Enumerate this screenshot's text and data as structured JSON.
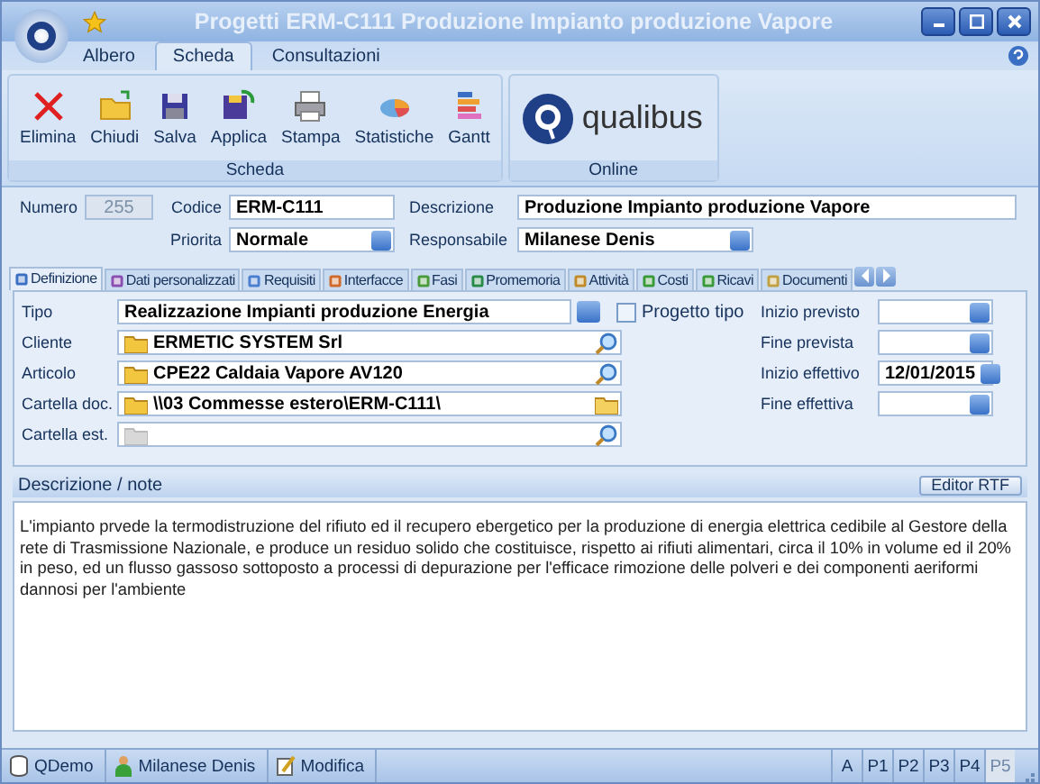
{
  "window": {
    "title": "Progetti ERM-C111 Produzione Impianto produzione Vapore"
  },
  "ribbon": {
    "tabs": [
      {
        "label": "Albero",
        "selected": false
      },
      {
        "label": "Scheda",
        "selected": true
      },
      {
        "label": "Consultazioni",
        "selected": false
      }
    ],
    "groups": [
      {
        "label": "Scheda",
        "buttons": [
          "Elimina",
          "Chiudi",
          "Salva",
          "Applica",
          "Stampa",
          "Statistiche",
          "Gantt"
        ]
      },
      {
        "label": "Online",
        "logo": "qualibus"
      }
    ]
  },
  "header": {
    "numero": {
      "label": "Numero",
      "value": "255",
      "disabled": true
    },
    "codice": {
      "label": "Codice",
      "value": "ERM-C111"
    },
    "descrizione": {
      "label": "Descrizione",
      "value": "Produzione Impianto produzione Vapore"
    },
    "priorita": {
      "label": "Priorita",
      "value": "Normale"
    },
    "responsabile": {
      "label": "Responsabile",
      "value": "Milanese Denis"
    }
  },
  "tabs": [
    {
      "label": "Definizione",
      "selected": true
    },
    {
      "label": "Dati personalizzati",
      "selected": false
    },
    {
      "label": "Requisiti",
      "selected": false
    },
    {
      "label": "Interfacce",
      "selected": false
    },
    {
      "label": "Fasi",
      "selected": false
    },
    {
      "label": "Promemoria",
      "selected": false
    },
    {
      "label": "Attività",
      "selected": false
    },
    {
      "label": "Costi",
      "selected": false
    },
    {
      "label": "Ricavi",
      "selected": false
    },
    {
      "label": "Documenti",
      "selected": false
    }
  ],
  "definizione": {
    "fields": [
      {
        "label": "Tipo",
        "value": "Realizzazione Impianti produzione Energia",
        "kind": "lookup"
      },
      {
        "label": "Cliente",
        "value": "ERMETIC SYSTEM Srl",
        "kind": "search",
        "disabled": false
      },
      {
        "label": "Articolo",
        "value": "CPE22 Caldaia Vapore AV120",
        "kind": "search",
        "disabled": false
      },
      {
        "label": "Cartella doc.",
        "value": "\\\\03 Commesse estero\\ERM-C111\\",
        "kind": "folder",
        "disabled": false
      },
      {
        "label": "Cartella est.",
        "kind": "search",
        "disabled": true
      }
    ],
    "progetto_tipo": {
      "label": "Progetto tipo",
      "checked": false
    },
    "dates": [
      {
        "label": "Inizio previsto"
      },
      {
        "label": "Fine prevista"
      },
      {
        "label": "Inizio effettivo",
        "value": "12/01/2015"
      },
      {
        "label": "Fine effettiva"
      }
    ]
  },
  "note": {
    "label": "Descrizione / note",
    "button": "Editor RTF",
    "text": "L'impianto prvede la termodistruzione del rifiuto ed il recupero ebergetico per la produzione di energia elettrica cedibile al Gestore della rete di Trasmissione Nazionale, e produce un residuo solido che costituisce, rispetto ai rifiuti alimentari, circa il 10% in volume ed il 20% in peso, ed un flusso gassoso sottoposto a processi di depurazione per l'efficace rimozione delle polveri e dei componenti aeriformi dannosi per l'ambiente"
  },
  "status_bar": {
    "items": [
      "QDemo",
      "Milanese Denis",
      "Modifica"
    ],
    "indicators": [
      {
        "label": "A",
        "disabled": false
      },
      {
        "label": "P1",
        "disabled": false
      },
      {
        "label": "P2",
        "disabled": false
      },
      {
        "label": "P3",
        "disabled": false
      },
      {
        "label": "P4",
        "disabled": false
      },
      {
        "label": "P5",
        "disabled": true
      }
    ]
  }
}
